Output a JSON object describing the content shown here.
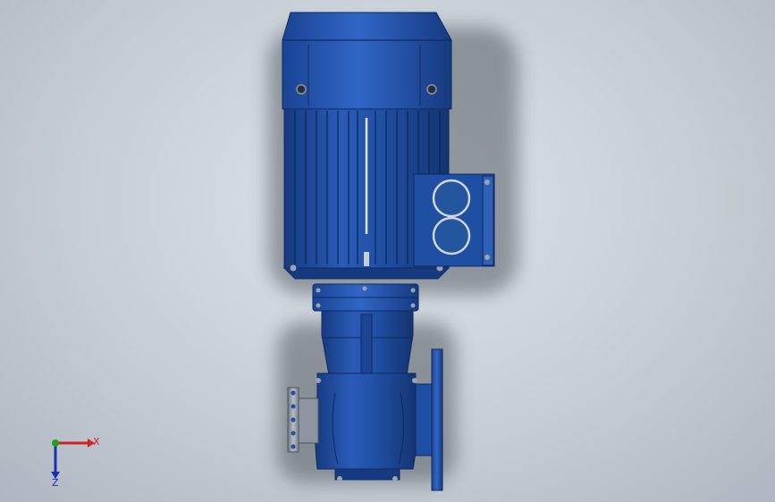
{
  "viewport": {
    "background_top": "#dfe4ea",
    "background_bottom": "#aeb7c1"
  },
  "model": {
    "name": "vertical-inline-pump-motor",
    "body_color": "#1f4fa3",
    "body_dark": "#163a80",
    "body_light": "#3a6cc4",
    "steel_color": "#9aa3ad"
  },
  "triad": {
    "x_label": "X",
    "z_label": "Z",
    "x_color": "#d42020",
    "y_color": "#20a020",
    "z_color": "#1a2fb0"
  }
}
